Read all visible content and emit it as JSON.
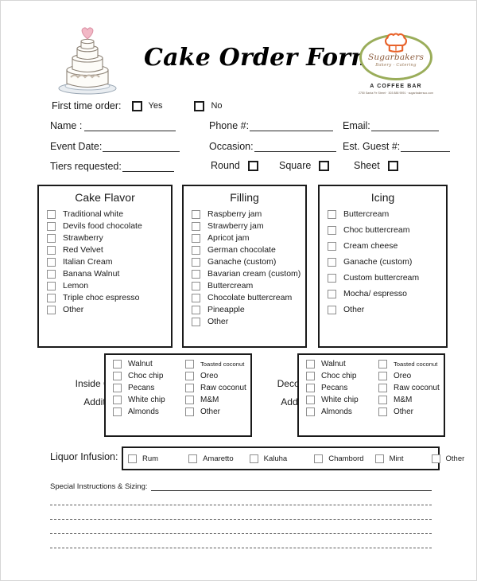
{
  "header": {
    "title": "Cake Order Form",
    "cake_icon": "wedding-cake-with-heart-topper-icon",
    "logo": {
      "hat_icon": "chef-hat-icon",
      "name": "Sugarbakers",
      "tagline": "Bakery  ·  Catering",
      "bar_text": "A COFFEE BAR",
      "address": "2750 Santa Fe Street  ·  303 888 9591  ·  sugarbakersco.com",
      "ring_color": "#9aad5a",
      "hat_color": "#e8622a"
    }
  },
  "first_time": {
    "label": "First time order:",
    "yes": "Yes",
    "no": "No"
  },
  "fields": {
    "name": "Name :",
    "phone": "Phone #:",
    "email": "Email:",
    "event_date": "Event Date:",
    "occasion": "Occasion:",
    "guests": "Est. Guest #:",
    "tiers": "Tiers requested:",
    "name_value": "",
    "phone_value": "",
    "email_value": "",
    "event_date_value": "",
    "occasion_value": "",
    "guests_value": "",
    "tiers_value": ""
  },
  "shape": {
    "round": "Round",
    "square": "Square",
    "sheet": "Sheet"
  },
  "panels": [
    {
      "title": "Cake Flavor",
      "options": [
        "Traditional white",
        "Devils food chocolate",
        "Strawberry",
        "Red Velvet",
        "Italian Cream",
        "Banana Walnut",
        "Lemon",
        "Triple  choc espresso",
        "Other"
      ]
    },
    {
      "title": "Filling",
      "options": [
        "Raspberry jam",
        "Strawberry jam",
        "Apricot jam",
        "German chocolate",
        "Ganache (custom)",
        "Bavarian cream (custom)",
        "Buttercream",
        "Chocolate buttercream",
        "Pineapple",
        "Other"
      ]
    },
    {
      "title": "Icing",
      "options": [
        "Buttercream",
        "Choc buttercream",
        "Cream cheese",
        "Ganache (custom)",
        "Custom buttercream",
        "Mocha/ espresso",
        "Other"
      ]
    }
  ],
  "additions": {
    "inside_label_line1": "Inside Cake",
    "inside_label_line2": "Additions:",
    "deco_label_line1": "Decorative",
    "deco_label_line2": "Additions:",
    "col_left": [
      "Walnut",
      "Choc chip",
      "Pecans",
      "White chip",
      "Almonds"
    ],
    "col_right": [
      "Toasted coconut",
      "Oreo",
      "Raw coconut",
      "M&M",
      "Other"
    ]
  },
  "liquor": {
    "label": "Liquor Infusion:",
    "options": [
      "Rum",
      "Amaretto",
      "Kaluha",
      "Chambord",
      "Mint",
      "Other"
    ]
  },
  "notes": {
    "label": "Special Instructions & Sizing:",
    "value": "",
    "blank_lines": 4
  }
}
